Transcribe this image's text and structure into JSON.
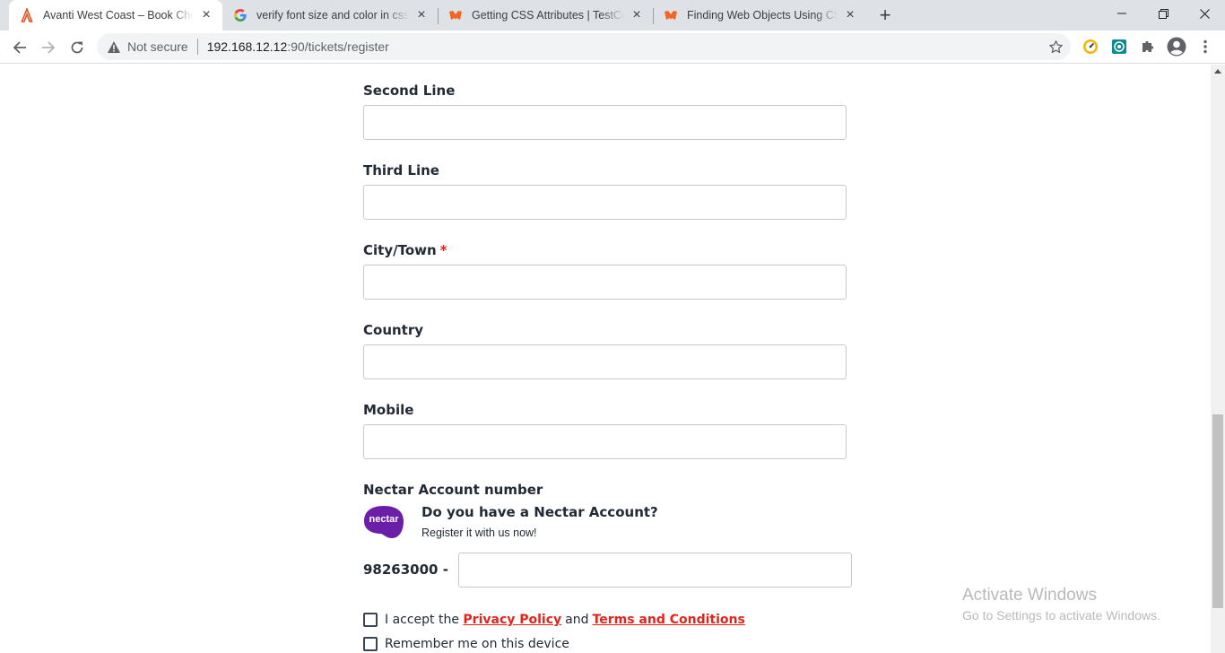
{
  "browser": {
    "tabs": [
      {
        "title": "Avanti West Coast – Book Cheap Train Tickets",
        "favicon": "avanti-logo-icon",
        "active": true
      },
      {
        "title": "verify font size and color in css in selenium",
        "favicon": "google-icon",
        "active": false
      },
      {
        "title": "Getting CSS Attributes | TestComplete Documentation",
        "favicon": "smartbear-icon",
        "active": false
      },
      {
        "title": "Finding Web Objects Using CSS Selectors",
        "favicon": "smartbear-icon",
        "active": false
      }
    ],
    "address": {
      "security_label": "Not secure",
      "host": "192.168.12.12",
      "path": ":90/tickets/register"
    }
  },
  "form": {
    "fields": [
      {
        "label": "Second Line",
        "required": false,
        "value": ""
      },
      {
        "label": "Third Line",
        "required": false,
        "value": ""
      },
      {
        "label": "City/Town",
        "required": true,
        "value": ""
      },
      {
        "label": "Country",
        "required": false,
        "value": ""
      },
      {
        "label": "Mobile",
        "required": false,
        "value": ""
      }
    ],
    "required_marker": "*",
    "nectar": {
      "label": "Nectar Account number",
      "logo_text": "nectar",
      "question": "Do you have a Nectar Account?",
      "subtext": "Register it with us now!",
      "prefix": "98263000 -",
      "value": ""
    },
    "consent": {
      "prefix": "I accept the",
      "privacy_link": "Privacy Policy",
      "and": "and",
      "terms_link": "Terms and Conditions"
    },
    "remember": "Remember me on this device"
  },
  "watermark": {
    "title": "Activate Windows",
    "subtitle": "Go to Settings to activate Windows."
  },
  "colors": {
    "accent_red": "#e2231a",
    "nectar_purple": "#6b1fa8",
    "text": "#222a35"
  }
}
